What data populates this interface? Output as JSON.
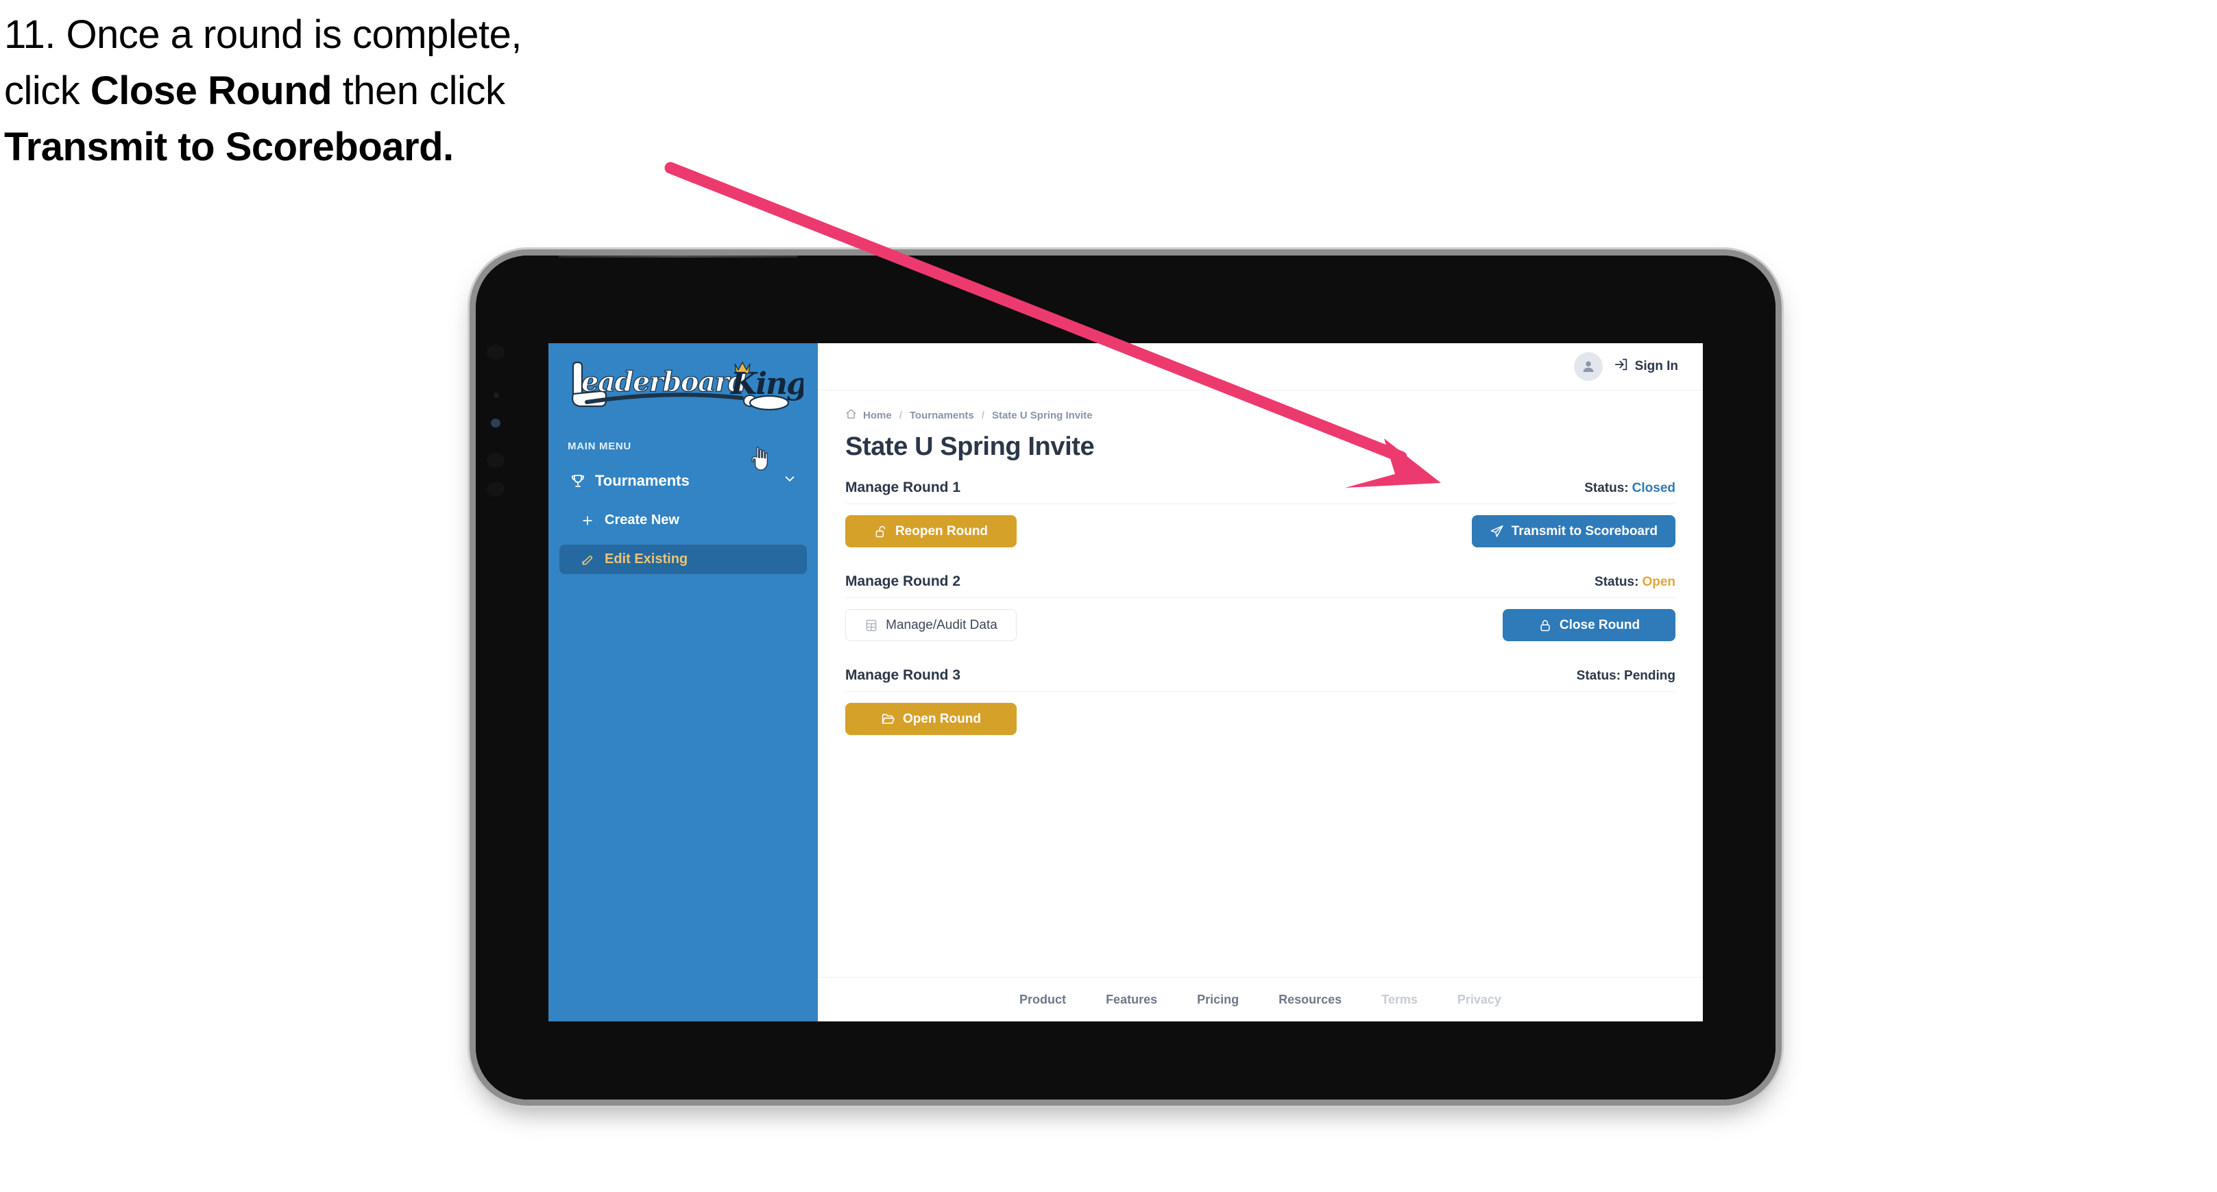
{
  "caption": {
    "lines": [
      [
        {
          "t": "11. Once a round is complete,",
          "b": false
        }
      ],
      [
        {
          "t": "click ",
          "b": false
        },
        {
          "t": "Close Round",
          "b": true
        },
        {
          "t": " then click",
          "b": false
        }
      ],
      [
        {
          "t": "Transmit to Scoreboard.",
          "b": true
        }
      ]
    ]
  },
  "annotation": {
    "arrow_color": "#ed3a6e",
    "arrow_name": "pointer-arrow"
  },
  "app": {
    "sidebar": {
      "logo_text_left": "Leaderboard",
      "logo_text_right": "King",
      "menu_heading": "MAIN MENU",
      "nav": {
        "label": "Tournaments",
        "icon": "trophy-icon",
        "chevron": "chevron-down-icon"
      },
      "sub_items": [
        {
          "label": "Create New",
          "icon": "plus-icon",
          "active": false
        },
        {
          "label": "Edit Existing",
          "icon": "edit-pencil-icon",
          "active": true
        }
      ],
      "background_color": "#3284c4",
      "active_background_color": "#2569a0",
      "active_text_color": "#ecc477"
    },
    "topbar": {
      "avatar_icon": "user-avatar-icon",
      "signin_icon": "sign-in-arrow-icon",
      "signin_label": "Sign In"
    },
    "breadcrumb": {
      "home_icon": "home-icon",
      "items": [
        "Home",
        "Tournaments",
        "State U Spring Invite"
      ],
      "separator": "/"
    },
    "page_title": "State U Spring Invite",
    "status_label": "Status:",
    "rounds": [
      {
        "name": "Manage Round 1",
        "status_value": "Closed",
        "status_color": "#2f7ab8",
        "left_button": {
          "label": "Reopen Round",
          "icon": "unlock-icon",
          "style": "gold"
        },
        "right_button": {
          "label": "Transmit to Scoreboard",
          "icon": "paper-plane-icon",
          "style": "blue"
        }
      },
      {
        "name": "Manage Round 2",
        "status_value": "Open",
        "status_color": "#e0a63a",
        "left_button": {
          "label": "Manage/Audit Data",
          "icon": "table-grid-icon",
          "style": "ghost"
        },
        "right_button": {
          "label": "Close Round",
          "icon": "lock-icon",
          "style": "blue"
        }
      },
      {
        "name": "Manage Round 3",
        "status_value": "Pending",
        "status_color": "#2b3648",
        "left_button": {
          "label": "Open Round",
          "icon": "open-folder-icon",
          "style": "gold"
        },
        "right_button": null
      }
    ],
    "footer": {
      "links": [
        {
          "label": "Product",
          "muted": false
        },
        {
          "label": "Features",
          "muted": false
        },
        {
          "label": "Pricing",
          "muted": false
        },
        {
          "label": "Resources",
          "muted": false
        },
        {
          "label": "Terms",
          "muted": true
        },
        {
          "label": "Privacy",
          "muted": true
        }
      ]
    },
    "cursor": "hand-pointer-cursor"
  }
}
